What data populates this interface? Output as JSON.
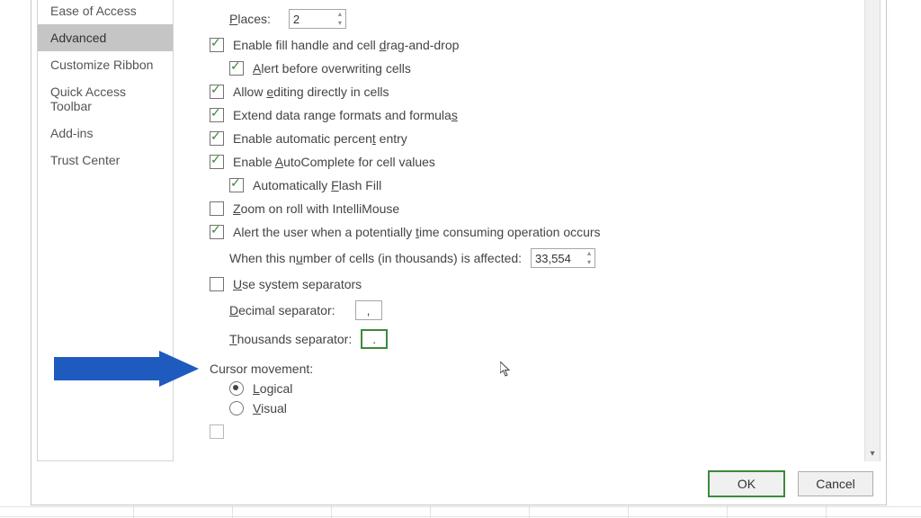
{
  "sidebar": {
    "items": [
      {
        "label": "Ease of Access",
        "selected": false
      },
      {
        "label": "Advanced",
        "selected": true
      },
      {
        "label": "Customize Ribbon",
        "selected": false
      },
      {
        "label": "Quick Access Toolbar",
        "selected": false
      },
      {
        "label": "Add-ins",
        "selected": false
      },
      {
        "label": "Trust Center",
        "selected": false
      }
    ]
  },
  "options": {
    "places_label": "Places:",
    "places_value": "2",
    "fill_handle": "Enable fill handle and cell drag-and-drop",
    "alert_overwrite": "Alert before overwriting cells",
    "allow_editing": "Allow editing directly in cells",
    "extend_formats": "Extend data range formats and formulas",
    "auto_percent": "Enable automatic percent entry",
    "autocomplete": "Enable AutoComplete for cell values",
    "flash_fill": "Automatically Flash Fill",
    "zoom_intellimouse": "Zoom on roll with IntelliMouse",
    "alert_timeconsuming": "Alert the user when a potentially time consuming operation occurs",
    "cells_affected_label": "When this number of cells (in thousands) is affected:",
    "cells_affected_value": "33,554",
    "use_system_sep": "Use system separators",
    "decimal_sep_label": "Decimal separator:",
    "decimal_sep_value": ",",
    "thousands_sep_label": "Thousands separator:",
    "thousands_sep_value": ".",
    "cursor_movement_label": "Cursor movement:",
    "cursor_logical": "Logical",
    "cursor_visual": "Visual"
  },
  "underlines": {
    "places_u": "P",
    "drag_u": "d",
    "alert_u": "A",
    "editing_u": "e",
    "extend_u": "s",
    "percent_u": "t",
    "autocomp_u": "A",
    "flash_u": "F",
    "zoom_u": "Z",
    "timeconsuming_u": "t",
    "number_u": "u",
    "system_u": "U",
    "decimal_u": "D",
    "thousands_u": "T",
    "logical_u": "L",
    "visual_u": "V"
  },
  "buttons": {
    "ok": "OK",
    "cancel": "Cancel"
  }
}
